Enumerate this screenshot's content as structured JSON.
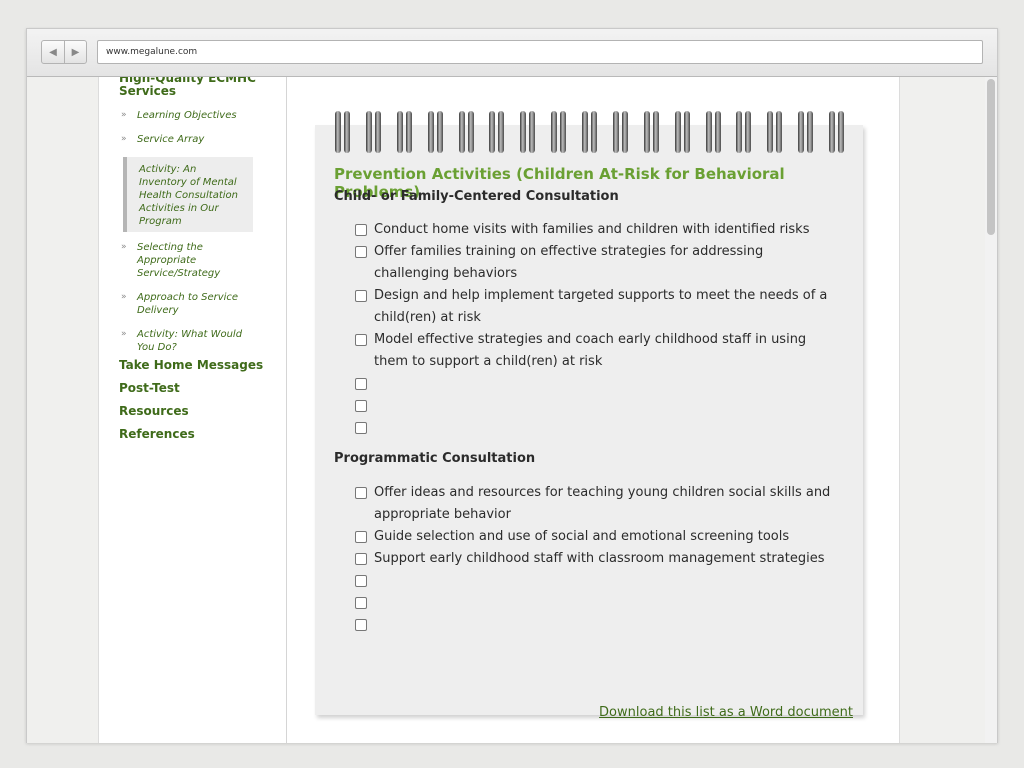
{
  "browser": {
    "url": "www.megalune.com",
    "back_glyph": "◀",
    "forward_glyph": "▶"
  },
  "sidebar": {
    "section_title": "High-Quality ECMHC Services",
    "arrow_glyph": "»",
    "subitems": [
      {
        "label": "Learning Objectives"
      },
      {
        "label": "Service Array"
      },
      {
        "label": "Activity: An Inventory of Mental Health Consultation Activities in Our Program"
      },
      {
        "label": "Selecting the Appropriate Service/Strategy"
      },
      {
        "label": "Approach to Service Delivery"
      },
      {
        "label": "Activity: What Would You Do?"
      }
    ],
    "main_items": [
      {
        "label": "Take Home Messages"
      },
      {
        "label": "Post-Test"
      },
      {
        "label": "Resources"
      },
      {
        "label": "References"
      }
    ]
  },
  "card": {
    "title": "Prevention Activities (Children At-Risk for Behavioral Problems)",
    "groups": [
      {
        "title": "Child- or Family-Centered Consultation",
        "items": [
          "Conduct home visits with families and children with identified risks",
          "Offer families training on effective strategies for addressing challenging behaviors",
          "Design and help implement targeted supports to meet the needs of a child(ren) at risk",
          "Model effective strategies and coach early childhood staff in using them to support a child(ren) at risk",
          "",
          "",
          ""
        ]
      },
      {
        "title": "Programmatic Consultation",
        "items": [
          "Offer ideas and resources for teaching young children social skills and appropriate behavior",
          "Guide selection and use of social and emotional screening tools",
          "Support early childhood staff with classroom management strategies",
          "",
          "",
          ""
        ]
      }
    ],
    "download_link": "Download this list as a Word document"
  },
  "colors": {
    "accent_green": "#6aa033",
    "nav_green": "#3f6b1a"
  }
}
